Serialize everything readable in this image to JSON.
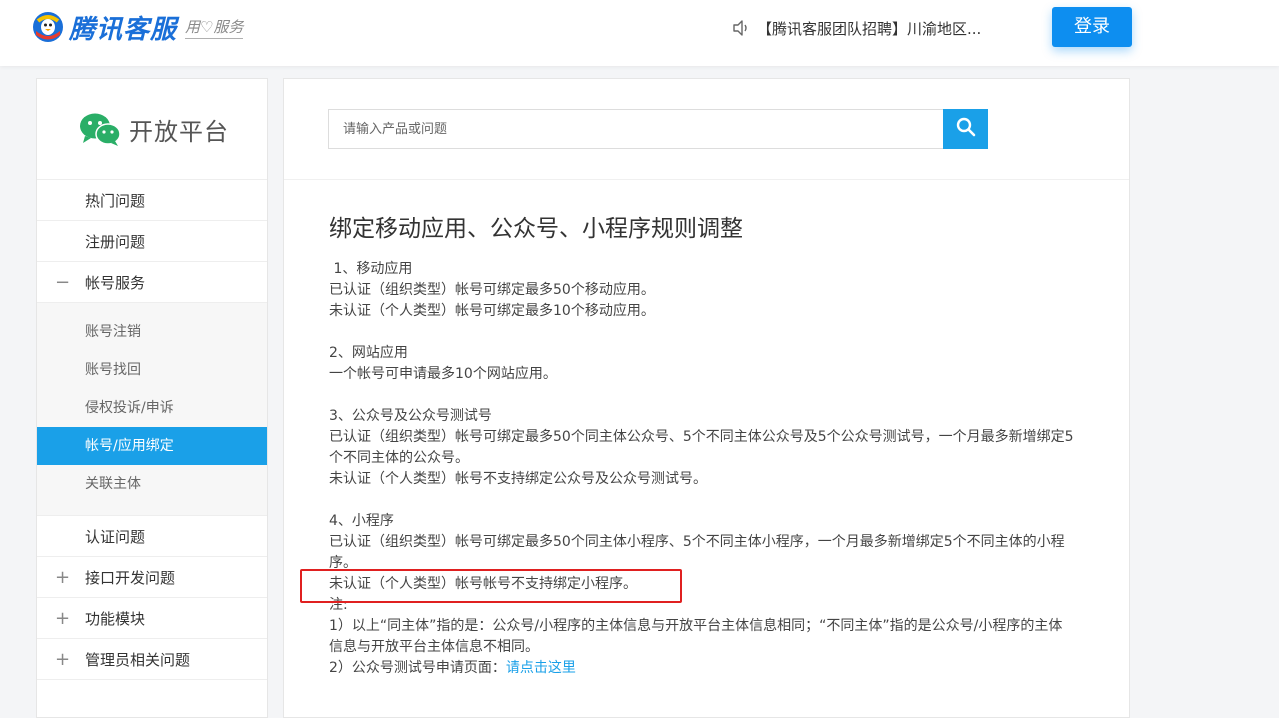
{
  "header": {
    "logo_name": "腾讯客服",
    "logo_slogan": "用♡服务",
    "notice_text": "【腾讯客服团队招聘】川渝地区...",
    "login_label": "登录",
    "colors": {
      "brand": "#1a6fd8",
      "primary": "#0d8ef0"
    },
    "icons": {
      "logo": "tencent-penguin-icon",
      "notice": "speaker-icon"
    }
  },
  "sidebar": {
    "brand_text": "开放平台",
    "brand_icon": "wechat-icon",
    "items": [
      {
        "label": "热门问题",
        "toggle": ""
      },
      {
        "label": "注册问题",
        "toggle": ""
      },
      {
        "label": "帐号服务",
        "toggle": "−"
      }
    ],
    "sub_items": [
      {
        "label": "账号注销"
      },
      {
        "label": "账号找回"
      },
      {
        "label": "侵权投诉/申诉"
      },
      {
        "label": "帐号/应用绑定"
      },
      {
        "label": "关联主体"
      }
    ],
    "items_after": [
      {
        "label": "认证问题",
        "toggle": ""
      },
      {
        "label": "接口开发问题",
        "toggle": "+"
      },
      {
        "label": "功能模块",
        "toggle": "+"
      },
      {
        "label": "管理员相关问题",
        "toggle": "+"
      }
    ],
    "active_color": "#1aa0e8"
  },
  "search": {
    "placeholder": "请输入产品或问题",
    "value": "",
    "icon": "search-icon"
  },
  "article": {
    "title": "绑定移动应用、公众号、小程序规则调整",
    "s1_head": " 1、移动应用",
    "s1_l1": "已认证（组织类型）帐号可绑定最多50个移动应用。",
    "s1_l2": "未认证（个人类型）帐号可绑定最多10个移动应用。",
    "s2_head": "2、网站应用",
    "s2_l1": "一个帐号可申请最多10个网站应用。",
    "s3_head": "3、公众号及公众号测试号",
    "s3_l1": "已认证（组织类型）帐号可绑定最多50个同主体公众号、5个不同主体公众号及5个公众号测试号，一个月最多新增绑定5个不同主体的公众号。",
    "s3_l2": "未认证（个人类型）帐号不支持绑定公众号及公众号测试号。",
    "s4_head": "4、小程序",
    "s4_l1": "已认证（组织类型）帐号可绑定最多50个同主体小程序、5个不同主体小程序，一个月最多新增绑定5个不同主体的小程序。",
    "s4_l2": "未认证（个人类型）帐号帐号不支持绑定小程序。",
    "note_head": "注:",
    "note_1": "1）以上“同主体”指的是：公众号/小程序的主体信息与开放平台主体信息相同；“不同主体”指的是公众号/小程序的主体信息与开放平台主体信息不相同。",
    "note_2_prefix": "2）公众号测试号申请页面：",
    "note_2_link": "请点击这里"
  }
}
